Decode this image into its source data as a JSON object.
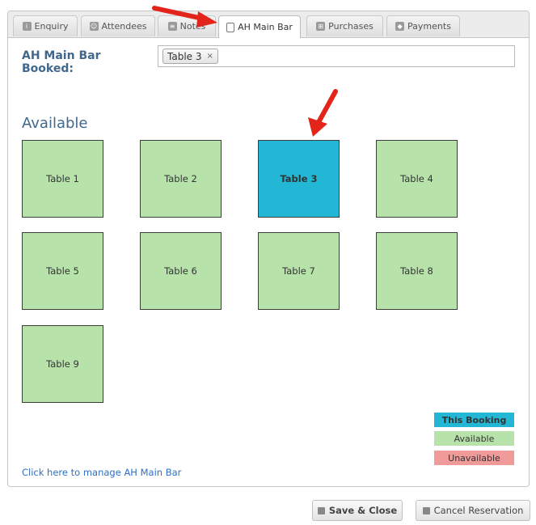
{
  "tabs": [
    {
      "label": "Enquiry",
      "icon": "info-icon"
    },
    {
      "label": "Attendees",
      "icon": "person-icon"
    },
    {
      "label": "Notes",
      "icon": "note-icon"
    },
    {
      "label": "AH Main Bar",
      "icon": "document-icon",
      "active": true
    },
    {
      "label": "Purchases",
      "icon": "cart-icon"
    },
    {
      "label": "Payments",
      "icon": "tag-icon"
    }
  ],
  "booked": {
    "label": "AH Main Bar Booked:",
    "chip_label": "Table 3",
    "chip_remove": "×"
  },
  "available_heading": "Available",
  "tables": [
    {
      "label": "Table 1",
      "status": "available"
    },
    {
      "label": "Table 2",
      "status": "available"
    },
    {
      "label": "Table 3",
      "status": "this-booking"
    },
    {
      "label": "Table 4",
      "status": "available"
    },
    {
      "label": "Table 5",
      "status": "available"
    },
    {
      "label": "Table 6",
      "status": "available"
    },
    {
      "label": "Table 7",
      "status": "available"
    },
    {
      "label": "Table 8",
      "status": "available"
    },
    {
      "label": "Table 9",
      "status": "available"
    }
  ],
  "legend": {
    "this_booking": "This Booking",
    "available": "Available",
    "unavailable": "Unavailable"
  },
  "colors": {
    "this_booking": "#22b7d5",
    "available": "#b7e3ab",
    "unavailable": "#f09a9a",
    "heading": "#41688c",
    "link": "#2f6fc4",
    "annotation_arrow": "#e3241b"
  },
  "manage_link": "Click here to manage AH Main Bar",
  "buttons": {
    "save_close": "Save & Close",
    "cancel_reservation": "Cancel Reservation"
  }
}
